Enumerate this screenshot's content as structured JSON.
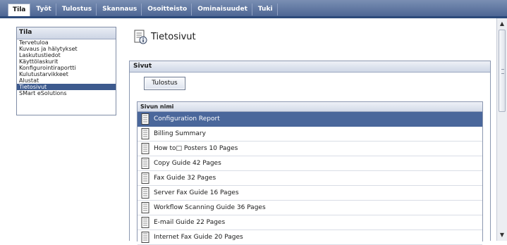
{
  "tabs": [
    {
      "label": "Tila",
      "active": true
    },
    {
      "label": "Työt",
      "active": false
    },
    {
      "label": "Tulostus",
      "active": false
    },
    {
      "label": "Skannaus",
      "active": false
    },
    {
      "label": "Osoitteisto",
      "active": false
    },
    {
      "label": "Ominaisuudet",
      "active": false
    },
    {
      "label": "Tuki",
      "active": false
    }
  ],
  "sidebar": {
    "title": "Tila",
    "items": [
      {
        "label": "Tervetuloa"
      },
      {
        "label": "Kuvaus ja hälytykset"
      },
      {
        "label": "Laskutustiedot"
      },
      {
        "label": "Käyttölaskurit"
      },
      {
        "label": "Konfigurointiraportti"
      },
      {
        "label": "Kulutustarvikkeet"
      },
      {
        "label": "Alustat"
      },
      {
        "label": "Tietosivut",
        "selected": true
      },
      {
        "label": "SMart eSolutions"
      }
    ]
  },
  "page": {
    "title": "Tietosivut",
    "icon": "info-page-icon"
  },
  "section": {
    "title": "Sivut",
    "print_button": "Tulostus",
    "table_header": "Sivun nimi",
    "rows": [
      {
        "label": "Configuration Report",
        "selected": true
      },
      {
        "label": "Billing Summary"
      },
      {
        "label": "How to□ Posters 10 Pages"
      },
      {
        "label": "Copy Guide 42 Pages"
      },
      {
        "label": "Fax Guide 32 Pages"
      },
      {
        "label": "Server Fax Guide 16 Pages"
      },
      {
        "label": "Workflow Scanning Guide 36 Pages"
      },
      {
        "label": "E-mail Guide 22 Pages"
      },
      {
        "label": "Internet Fax Guide 20 Pages"
      }
    ]
  },
  "colors": {
    "topbar": "#4d6694",
    "selection": "#4a679b",
    "border": "#8b97b0"
  }
}
